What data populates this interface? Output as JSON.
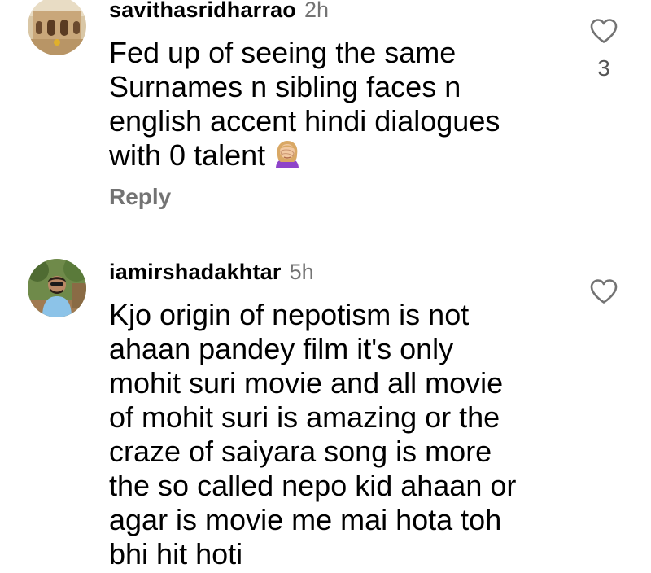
{
  "comments": [
    {
      "username": "savithasridharrao",
      "time": "2h",
      "text": "Fed up of seeing the same\nSurnames n sibling faces n\nenglish accent hindi dialogues\nwith 0 talent",
      "emoji": "woman-facepalming-icon",
      "reply_label": "Reply",
      "like_count": "3",
      "like_icon": "heart-outline-icon"
    },
    {
      "username": "iamirshadakhtar",
      "time": "5h",
      "text": "Kjo origin of nepotism is not\nahaan pandey film it's only\nmohit suri movie and all movie\nof mohit suri is amazing or the\ncraze of saiyara song is more\nthe so called nepo kid ahaan or\nagar is movie me mai hota toh\nbhi hit hoti",
      "like_icon": "heart-outline-icon"
    }
  ],
  "colors": {
    "text": "#000000",
    "secondary": "#737373",
    "background": "#ffffff"
  }
}
